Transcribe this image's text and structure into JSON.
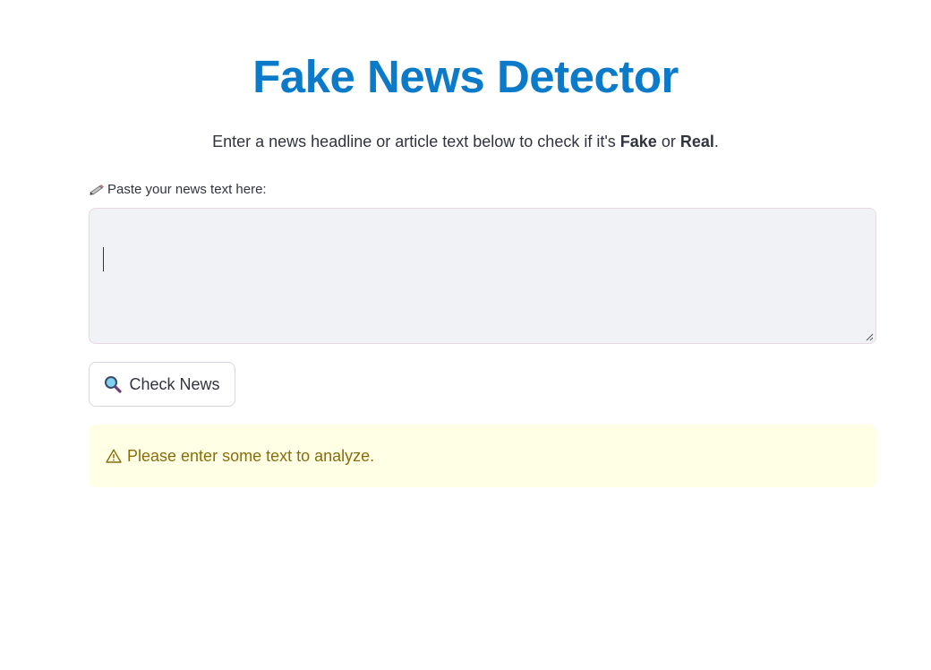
{
  "header": {
    "title": "Fake News Detector",
    "subtitle_prefix": "Enter a news headline or article text below to check if it's ",
    "subtitle_fake": "Fake",
    "subtitle_or": " or ",
    "subtitle_real": "Real",
    "subtitle_suffix": "."
  },
  "input": {
    "label": "Paste your news text here:",
    "label_icon": "pencil-icon",
    "value": "",
    "placeholder": ""
  },
  "button": {
    "label": "Check News",
    "icon": "magnifier-icon"
  },
  "alert": {
    "icon": "warning-icon",
    "message": "Please enter some text to analyze."
  },
  "colors": {
    "title": "#0b7ac9",
    "alert_background": "#ffffe6",
    "alert_text": "#8a6d0b",
    "input_background": "#f0f2f6"
  }
}
